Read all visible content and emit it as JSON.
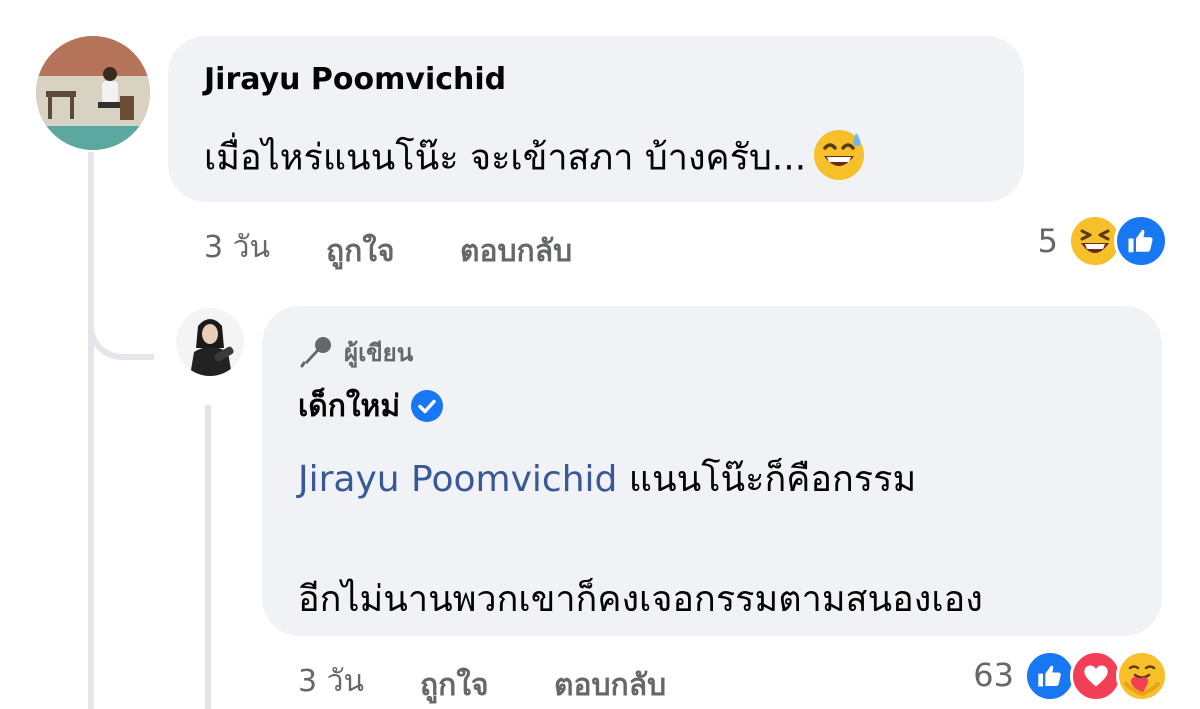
{
  "comment": {
    "author": "Jirayu Poomvichid",
    "text": "เมื่อไหร่แนนโน๊ะ จะเข้าสภา บ้างครับ...",
    "emoji": "sweat-smile",
    "time": "3 วัน",
    "like_label": "ถูกใจ",
    "reply_label": "ตอบกลับ",
    "reaction_count": "5",
    "reactions": [
      "haha",
      "like"
    ]
  },
  "reply": {
    "badge_label": "ผู้เขียน",
    "author": "เด็กใหม่",
    "verified": true,
    "mention": "Jirayu Poomvichid",
    "line1": " แนนโน๊ะก็คือกรรม",
    "line2": "อีกไม่นานพวกเขาก็คงเจอกรรมตามสนองเอง",
    "time": "3 วัน",
    "like_label": "ถูกใจ",
    "reply_label": "ตอบกลับ",
    "reaction_count": "63",
    "reactions": [
      "like",
      "love",
      "care"
    ]
  },
  "colors": {
    "bubble": "#f0f2f5",
    "mention": "#385898",
    "like_blue": "#1877f2",
    "love_red": "#f33e58",
    "emoji_yellow": "#f7c02a",
    "verified_blue": "#1877f2",
    "meta_gray": "#65676b"
  }
}
